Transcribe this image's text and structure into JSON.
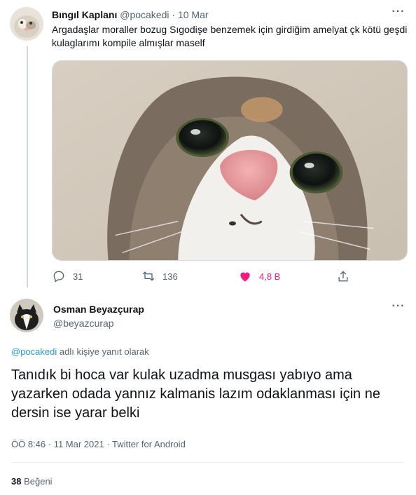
{
  "parent_tweet": {
    "display_name": "Bıngıl Kaplanı",
    "handle": "@pocakedi",
    "separator": "·",
    "date": "10 Mar",
    "text": "Argadaşlar moraller bozug Sıgodişe benzemek için girdiğim amelyat çk kötü geşdi kulaglarımı kompile almışlar maself",
    "media_icon": "cat-photo",
    "more_icon": "more-dots-icon",
    "actions": {
      "reply_count": "31",
      "retweet_count": "136",
      "like_count": "4,8 B",
      "like_color": "#f91880"
    }
  },
  "reply_tweet": {
    "display_name": "Osman Beyazçurap",
    "handle": "@beyazcurap",
    "replying_mention": "@pocakedi",
    "replying_suffix": "adlı kişiye yanıt olarak",
    "text": "Tanıdık bi hoca var kulak uzadma musgası yabıyo ama yazarken odada yannız kalmanis lazım odaklanması için ne dersin ise yarar belki",
    "meta": "ÖÖ 8:46 · 11 Mar 2021 · Twitter for Android",
    "like_count": "38",
    "like_label": "Beğeni"
  },
  "colors": {
    "link": "#1d9bf0",
    "muted": "#536471",
    "text": "#0f1419",
    "thread_line": "#cfd9de"
  }
}
